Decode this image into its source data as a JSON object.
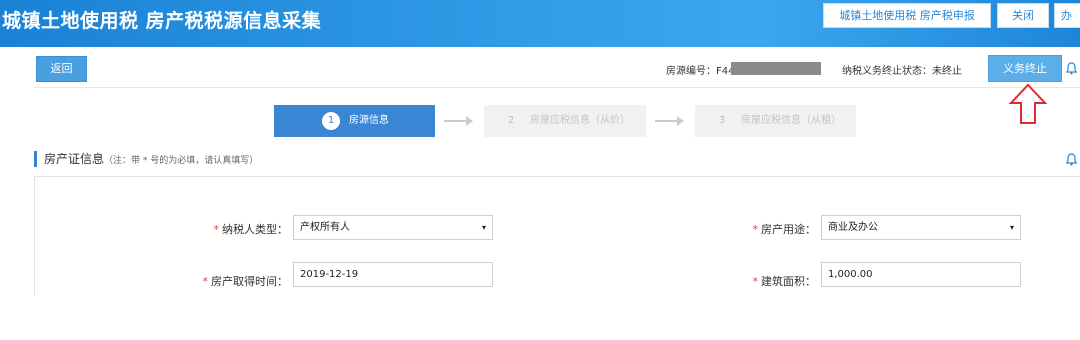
{
  "header": {
    "title": "城镇土地使用税 房产税税源信息采集",
    "buttons": [
      "城镇土地使用税 房产税申报",
      "关闭",
      "办"
    ]
  },
  "toolbar": {
    "back_label": "返回",
    "house_no_label": "房源编号：F44",
    "status_label": "纳税义务终止状态：未终止",
    "terminate_label": "义务终止"
  },
  "steps": [
    {
      "num": "1",
      "label": "房源信息"
    },
    {
      "num": "2",
      "label": "房屋应税信息（从价）"
    },
    {
      "num": "3",
      "label": "房屋应税信息（从租）"
    }
  ],
  "section": {
    "title": "房产证信息",
    "note": "（注：带 * 号的为必填，请认真填写）"
  },
  "form": {
    "required_mark": "*",
    "taxpayer_type": {
      "label": "纳税人类型：",
      "value": "产权所有人"
    },
    "house_use": {
      "label": "房产用途：",
      "value": "商业及办公"
    },
    "acquire_time": {
      "label": "房产取得时间：",
      "value": "2019-12-19"
    },
    "building_area": {
      "label": "建筑面积：",
      "value": "1,000.00"
    }
  },
  "icons": {
    "bell": "bell-icon",
    "arrow": "up-arrow-annotation-icon",
    "caret": "▾"
  },
  "colors": {
    "brand_blue": "#2b87d3",
    "active_step": "#3a86d4",
    "required": "#e23b3b",
    "annotation": "#e0282e"
  }
}
